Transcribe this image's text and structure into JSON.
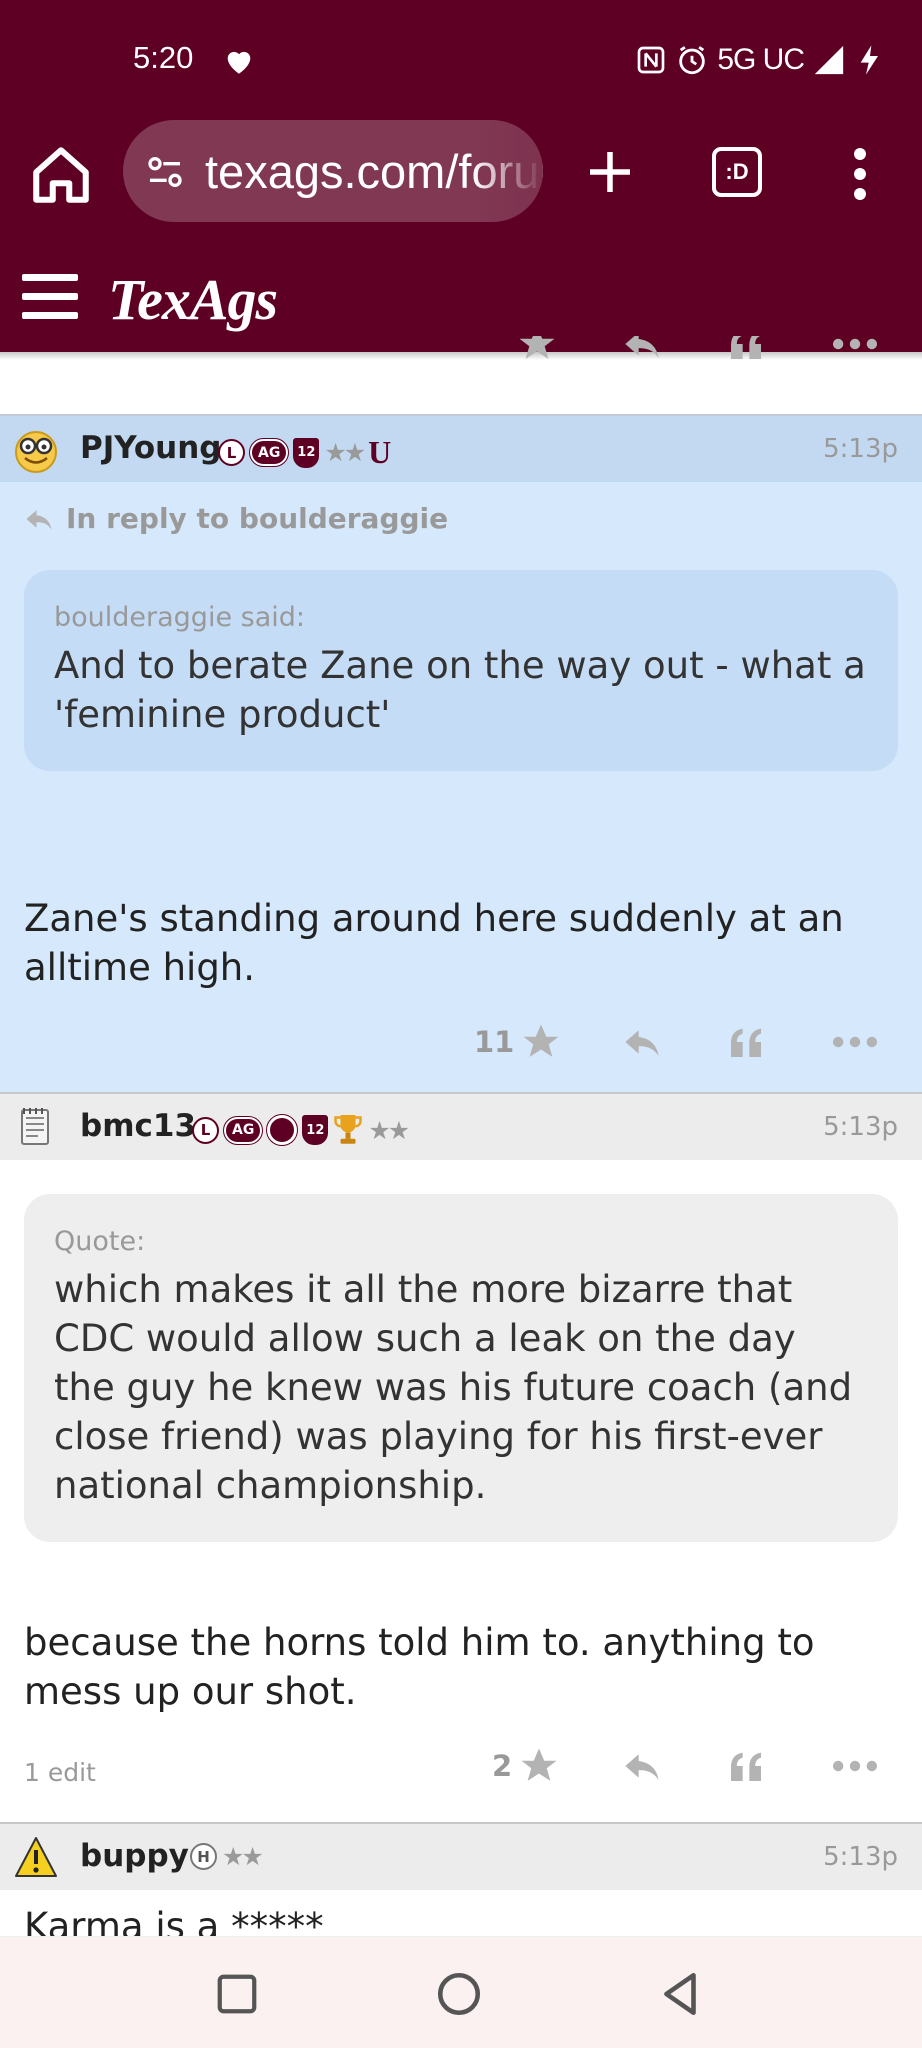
{
  "status_bar": {
    "time": "5:20",
    "network": "5G UC"
  },
  "browser": {
    "url": "texags.com/forums",
    "tab_count_label": ":D"
  },
  "site": {
    "logo": "TexAgs",
    "brand_color": "#5e0023"
  },
  "posts": [
    {
      "username": "PJYoung",
      "badges": [
        "L",
        "AG",
        "12",
        "★★",
        "U"
      ],
      "time": "5:13p",
      "reply_to": "In reply to boulderaggie",
      "quote_label": "boulderaggie said:",
      "quote_text": "And to berate Zane on the way out - what a 'feminine product'",
      "body": "Zane's standing around here suddenly at an alltime high.",
      "star_count": "11",
      "highlight_color": "#d6e8fb"
    },
    {
      "username": "bmc13",
      "badges": [
        "L",
        "AG",
        "12",
        "★★"
      ],
      "time": "5:13p",
      "quote_label": "Quote:",
      "quote_text": "which makes it all the more bizarre that CDC would allow such a leak on the day the guy he knew was his future coach (and close friend) was playing for his first-ever national championship.",
      "body": "because the horns told him to. anything to mess up our shot.",
      "edit_note": "1 edit",
      "star_count": "2"
    },
    {
      "username": "buppy",
      "badges": [
        "H",
        "★★"
      ],
      "time": "5:13p",
      "body": "Karma is a *****"
    }
  ]
}
